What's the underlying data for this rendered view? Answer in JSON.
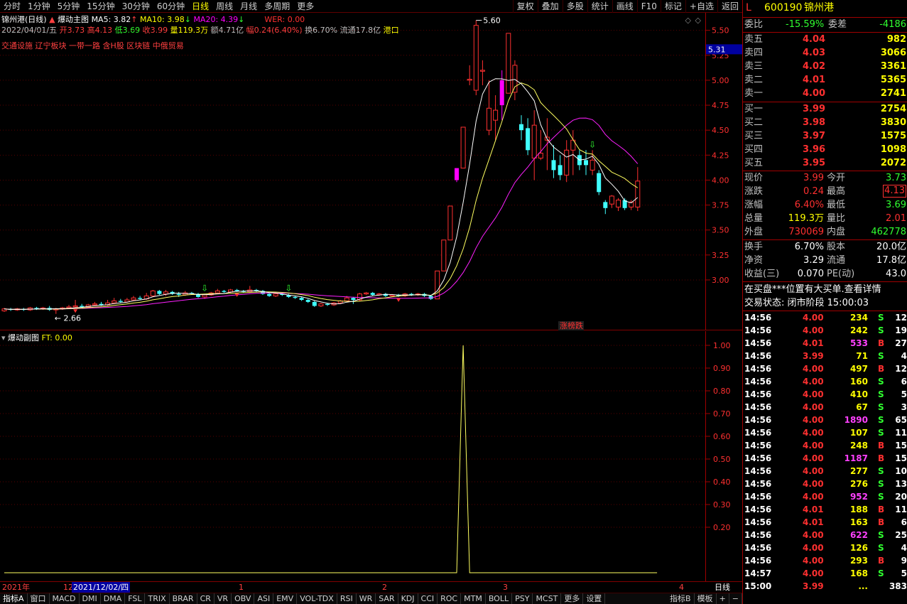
{
  "toolbar": {
    "periods": [
      "分时",
      "1分钟",
      "5分钟",
      "15分钟",
      "30分钟",
      "60分钟",
      "日线",
      "周线",
      "月线",
      "多周期",
      "更多"
    ],
    "active": "日线",
    "right": [
      "复权",
      "叠加",
      "多股",
      "统计",
      "画线",
      "F10",
      "标记",
      "+自选",
      "返回"
    ]
  },
  "info": {
    "title": "锦州港(日线)",
    "indicator": "爆动主图",
    "ma5": "MA5: 3.82",
    "ma10": "MA10: 3.98",
    "ma20": "MA20: 4.39",
    "wer": "WER: 0.00",
    "date": "2022/04/01/五",
    "open": "开3.73",
    "high": "高4.13",
    "low": "低3.69",
    "close": "收3.99",
    "vol": "量119.3万",
    "amount": "额4.71亿",
    "range": "幅0.24(6.40%)",
    "turnover": "换6.70%",
    "float": "流通17.8亿",
    "market": "港口",
    "concepts": "交通设施 辽宁板块 一带一路 含H股 区块链 中俄贸易"
  },
  "main_chart": {
    "y_ticks": [
      "5.50",
      "5.25",
      "5.00",
      "4.75",
      "4.50",
      "4.25",
      "4.00",
      "3.75",
      "3.50",
      "3.25",
      "3.00"
    ],
    "cursor_price": "5.31",
    "peak_label": "5.60",
    "low_label": "2.66",
    "tag": "涨榜跌",
    "colors": {
      "up": "#ff3030",
      "down": "#40ffff",
      "hot": "#ff00ff",
      "ma5": "#ffffff",
      "ma10": "#ffff60",
      "ma20": "#ff20ff"
    }
  },
  "sub_chart": {
    "title": "爆动副图",
    "ft": "FT: 0.00",
    "y_ticks": [
      "1.00",
      "0.90",
      "0.80",
      "0.70",
      "0.60",
      "0.50",
      "0.40",
      "0.30",
      "0.20"
    ]
  },
  "xaxis": {
    "year": "2021年",
    "m12": "12",
    "cursor_date": "2021/12/02/四",
    "m1": "1",
    "m2": "2",
    "m3": "3",
    "m4": "4",
    "period": "日线"
  },
  "bottom_tabs": [
    "指标A",
    "窗口",
    "MACD",
    "DMI",
    "DMA",
    "FSL",
    "TRIX",
    "BRAR",
    "CR",
    "VR",
    "OBV",
    "ASI",
    "EMV",
    "VOL-TDX",
    "RSI",
    "WR",
    "SAR",
    "KDJ",
    "CCI",
    "ROC",
    "MTM",
    "BOLL",
    "PSY",
    "MCST",
    "更多",
    "设置"
  ],
  "bottom_right": [
    "指标B",
    "模板",
    "+",
    "−"
  ],
  "quote": {
    "code": "600190",
    "name": "锦州港",
    "flag": "L",
    "weibi_label": "委比",
    "weibi": "-15.59%",
    "weicha_label": "委差",
    "weicha": "-4186",
    "asks": [
      {
        "label": "卖五",
        "price": "4.04",
        "vol": "982"
      },
      {
        "label": "卖四",
        "price": "4.03",
        "vol": "3066"
      },
      {
        "label": "卖三",
        "price": "4.02",
        "vol": "3361"
      },
      {
        "label": "卖二",
        "price": "4.01",
        "vol": "5365"
      },
      {
        "label": "卖一",
        "price": "4.00",
        "vol": "2741"
      }
    ],
    "bids": [
      {
        "label": "买一",
        "price": "3.99",
        "vol": "2754"
      },
      {
        "label": "买二",
        "price": "3.98",
        "vol": "3830"
      },
      {
        "label": "买三",
        "price": "3.97",
        "vol": "1575"
      },
      {
        "label": "买四",
        "price": "3.96",
        "vol": "1098"
      },
      {
        "label": "买五",
        "price": "3.95",
        "vol": "2072"
      }
    ],
    "stats": [
      {
        "l1": "现价",
        "v1": "3.99",
        "l2": "今开",
        "v2": "3.73"
      },
      {
        "l1": "涨跌",
        "v1": "0.24",
        "l2": "最高",
        "v2": "4.13"
      },
      {
        "l1": "涨幅",
        "v1": "6.40%",
        "l2": "最低",
        "v2": "3.69"
      },
      {
        "l1": "总量",
        "v1": "119.3万",
        "l2": "量比",
        "v2": "2.01"
      },
      {
        "l1": "外盘",
        "v1": "730069",
        "l2": "内盘",
        "v2": "462778"
      }
    ],
    "stats2": [
      {
        "l1": "换手",
        "v1": "6.70%",
        "l2": "股本",
        "v2": "20.0亿"
      },
      {
        "l1": "净资",
        "v1": "3.29",
        "l2": "流通",
        "v2": "17.8亿"
      },
      {
        "l1": "收益(三)",
        "v1": "0.070",
        "l2": "PE(动)",
        "v2": "43.0"
      }
    ],
    "notice": "在买盘***位置有大买单.查看详情",
    "status": "交易状态: 闭市阶段 15:00:03"
  },
  "ticks": [
    {
      "t": "14:56",
      "p": "4.00",
      "v": "234",
      "bs": "S",
      "n": "12"
    },
    {
      "t": "14:56",
      "p": "4.00",
      "v": "242",
      "bs": "S",
      "n": "19"
    },
    {
      "t": "14:56",
      "p": "4.01",
      "v": "533",
      "bs": "B",
      "n": "27"
    },
    {
      "t": "14:56",
      "p": "3.99",
      "v": "71",
      "bs": "S",
      "n": "4"
    },
    {
      "t": "14:56",
      "p": "4.00",
      "v": "497",
      "bs": "B",
      "n": "12"
    },
    {
      "t": "14:56",
      "p": "4.00",
      "v": "160",
      "bs": "S",
      "n": "6"
    },
    {
      "t": "14:56",
      "p": "4.00",
      "v": "410",
      "bs": "S",
      "n": "5"
    },
    {
      "t": "14:56",
      "p": "4.00",
      "v": "67",
      "bs": "S",
      "n": "3"
    },
    {
      "t": "14:56",
      "p": "4.00",
      "v": "1890",
      "bs": "S",
      "n": "65"
    },
    {
      "t": "14:56",
      "p": "4.00",
      "v": "107",
      "bs": "S",
      "n": "11"
    },
    {
      "t": "14:56",
      "p": "4.00",
      "v": "248",
      "bs": "B",
      "n": "15"
    },
    {
      "t": "14:56",
      "p": "4.00",
      "v": "1187",
      "bs": "B",
      "n": "15"
    },
    {
      "t": "14:56",
      "p": "4.00",
      "v": "277",
      "bs": "S",
      "n": "10"
    },
    {
      "t": "14:56",
      "p": "4.00",
      "v": "276",
      "bs": "S",
      "n": "13"
    },
    {
      "t": "14:56",
      "p": "4.00",
      "v": "952",
      "bs": "S",
      "n": "20"
    },
    {
      "t": "14:56",
      "p": "4.01",
      "v": "188",
      "bs": "B",
      "n": "11"
    },
    {
      "t": "14:56",
      "p": "4.01",
      "v": "163",
      "bs": "B",
      "n": "6"
    },
    {
      "t": "14:56",
      "p": "4.00",
      "v": "622",
      "bs": "S",
      "n": "25"
    },
    {
      "t": "14:56",
      "p": "4.00",
      "v": "126",
      "bs": "S",
      "n": "4"
    },
    {
      "t": "14:56",
      "p": "4.00",
      "v": "293",
      "bs": "B",
      "n": "9"
    },
    {
      "t": "14:57",
      "p": "4.00",
      "v": "168",
      "bs": "S",
      "n": "5"
    },
    {
      "t": "15:00",
      "p": "3.99",
      "v": "...",
      "bs": "",
      "n": "383"
    }
  ],
  "candles": [
    [
      2.69,
      2.71,
      2.72,
      2.68
    ],
    [
      2.71,
      2.7,
      2.72,
      2.69
    ],
    [
      2.7,
      2.71,
      2.72,
      2.69
    ],
    [
      2.71,
      2.7,
      2.72,
      2.69
    ],
    [
      2.7,
      2.72,
      2.73,
      2.69
    ],
    [
      2.72,
      2.71,
      2.73,
      2.7
    ],
    [
      2.71,
      2.72,
      2.73,
      2.7
    ],
    [
      2.72,
      2.7,
      2.74,
      2.69
    ],
    [
      2.7,
      2.71,
      2.72,
      2.66
    ],
    [
      2.71,
      2.72,
      2.73,
      2.7
    ],
    [
      2.72,
      2.73,
      2.75,
      2.71
    ],
    [
      2.73,
      2.74,
      2.8,
      2.72
    ],
    [
      2.74,
      2.73,
      2.76,
      2.72
    ],
    [
      2.73,
      2.75,
      2.76,
      2.72
    ],
    [
      2.75,
      2.76,
      2.78,
      2.74
    ],
    [
      2.76,
      2.75,
      2.78,
      2.74
    ],
    [
      2.75,
      2.77,
      2.8,
      2.74
    ],
    [
      2.77,
      2.79,
      2.82,
      2.76
    ],
    [
      2.79,
      2.78,
      2.81,
      2.77
    ],
    [
      2.78,
      2.8,
      2.82,
      2.77
    ],
    [
      2.8,
      2.82,
      2.84,
      2.79
    ],
    [
      2.82,
      2.81,
      2.84,
      2.8
    ],
    [
      2.81,
      2.84,
      2.87,
      2.8
    ],
    [
      2.84,
      2.89,
      2.9,
      2.83
    ],
    [
      2.89,
      2.86,
      2.9,
      2.85
    ],
    [
      2.86,
      2.88,
      2.9,
      2.84
    ],
    [
      2.88,
      2.86,
      2.89,
      2.85
    ],
    [
      2.86,
      2.85,
      2.88,
      2.83
    ],
    [
      2.85,
      2.87,
      2.89,
      2.84
    ],
    [
      2.87,
      2.86,
      2.88,
      2.85
    ],
    [
      2.86,
      2.83,
      2.87,
      2.82
    ],
    [
      2.83,
      2.85,
      2.86,
      2.81
    ],
    [
      2.85,
      2.87,
      2.88,
      2.84
    ],
    [
      2.87,
      2.89,
      2.91,
      2.86
    ],
    [
      2.89,
      2.88,
      2.9,
      2.87
    ],
    [
      2.88,
      2.9,
      2.91,
      2.87
    ],
    [
      2.9,
      2.89,
      2.91,
      2.88
    ],
    [
      2.89,
      2.88,
      2.9,
      2.87
    ],
    [
      2.88,
      2.9,
      2.94,
      2.87
    ],
    [
      2.9,
      2.89,
      2.91,
      2.88
    ],
    [
      2.89,
      2.86,
      2.9,
      2.85
    ],
    [
      2.86,
      2.84,
      2.87,
      2.83
    ],
    [
      2.84,
      2.86,
      2.87,
      2.83
    ],
    [
      2.86,
      2.85,
      2.87,
      2.84
    ],
    [
      2.85,
      2.83,
      2.86,
      2.82
    ],
    [
      2.83,
      2.82,
      2.84,
      2.81
    ],
    [
      2.82,
      2.8,
      2.83,
      2.79
    ],
    [
      2.8,
      2.78,
      2.81,
      2.77
    ],
    [
      2.78,
      2.74,
      2.79,
      2.73
    ],
    [
      2.74,
      2.76,
      2.77,
      2.73
    ],
    [
      2.76,
      2.75,
      2.77,
      2.74
    ],
    [
      2.75,
      2.77,
      2.78,
      2.74
    ],
    [
      2.77,
      2.79,
      2.8,
      2.76
    ],
    [
      2.79,
      2.82,
      2.84,
      2.78
    ],
    [
      2.82,
      2.8,
      2.83,
      2.76
    ],
    [
      2.8,
      2.86,
      2.87,
      2.79
    ],
    [
      2.86,
      2.87,
      2.88,
      2.85
    ],
    [
      2.87,
      2.85,
      2.88,
      2.84
    ],
    [
      2.85,
      2.86,
      2.87,
      2.84
    ],
    [
      2.86,
      2.84,
      2.87,
      2.83
    ],
    [
      2.84,
      2.85,
      2.86,
      2.83
    ],
    [
      2.85,
      2.84,
      2.86,
      2.83
    ],
    [
      2.84,
      2.86,
      2.87,
      2.83
    ],
    [
      2.86,
      2.85,
      2.87,
      2.84
    ],
    [
      2.85,
      2.86,
      2.87,
      2.84
    ],
    [
      2.86,
      2.84,
      2.87,
      2.83
    ],
    [
      2.84,
      2.81,
      2.85,
      2.8
    ],
    [
      2.81,
      3.09,
      3.09,
      2.81
    ],
    [
      3.09,
      3.4,
      3.4,
      3.09
    ],
    [
      3.4,
      3.74,
      3.74,
      3.4
    ],
    [
      4.0,
      4.12,
      4.12,
      3.98
    ],
    [
      4.12,
      4.53,
      4.53,
      4.12
    ],
    [
      5.0,
      5.01,
      5.15,
      4.95
    ],
    [
      4.9,
      5.55,
      5.6,
      4.85
    ],
    [
      5.09,
      5.1,
      5.2,
      4.95
    ],
    [
      4.5,
      4.72,
      5.0,
      4.45
    ],
    [
      4.6,
      4.7,
      4.85,
      4.4
    ],
    [
      4.75,
      5.0,
      5.1,
      4.6
    ],
    [
      4.87,
      5.47,
      5.47,
      4.87
    ],
    [
      4.88,
      5.15,
      5.2,
      4.8
    ],
    [
      4.56,
      4.5,
      4.65,
      4.4
    ],
    [
      4.52,
      4.3,
      4.62,
      4.25
    ],
    [
      4.22,
      4.55,
      4.7,
      4.0
    ],
    [
      4.22,
      4.27,
      4.5,
      4.2
    ],
    [
      4.4,
      4.43,
      4.62,
      4.1
    ],
    [
      4.2,
      4.1,
      4.35,
      4.02
    ],
    [
      4.15,
      4.05,
      4.25,
      4.0
    ],
    [
      4.05,
      4.3,
      4.4,
      3.98
    ],
    [
      4.3,
      4.4,
      4.5,
      4.05
    ],
    [
      4.25,
      4.15,
      4.3,
      4.1
    ],
    [
      4.2,
      4.15,
      4.3,
      4.05
    ],
    [
      4.1,
      4.2,
      4.3,
      4.05
    ],
    [
      4.07,
      3.88,
      4.1,
      3.85
    ],
    [
      3.78,
      3.72,
      3.8,
      3.66
    ],
    [
      3.76,
      3.84,
      3.85,
      3.72
    ],
    [
      3.73,
      3.8,
      3.82,
      3.69
    ],
    [
      3.8,
      3.72,
      3.82,
      3.7
    ],
    [
      3.73,
      3.78,
      3.8,
      3.7
    ],
    [
      3.73,
      3.99,
      4.13,
      3.69
    ]
  ],
  "ft": [
    0,
    0,
    0,
    0,
    0,
    0,
    0,
    0,
    0,
    0,
    0,
    0,
    0,
    0,
    0,
    0,
    0,
    0,
    0,
    0,
    0,
    0,
    0,
    0,
    0,
    0,
    0,
    0,
    0,
    0,
    0,
    0,
    0,
    0,
    0,
    0,
    0,
    0,
    0,
    0,
    0,
    0,
    0,
    0,
    0,
    0,
    0,
    0,
    0,
    0,
    0,
    0,
    0,
    0,
    0,
    0,
    0,
    0,
    0,
    0,
    0,
    0,
    0,
    0,
    0,
    0,
    0,
    0,
    0,
    0,
    0,
    1.0,
    0,
    0,
    0,
    0,
    0,
    0,
    0,
    0,
    0,
    0,
    0,
    0,
    0,
    0,
    0,
    0,
    0,
    0,
    0,
    0,
    0,
    0,
    0,
    0,
    0,
    0,
    0,
    0,
    0,
    0
  ]
}
